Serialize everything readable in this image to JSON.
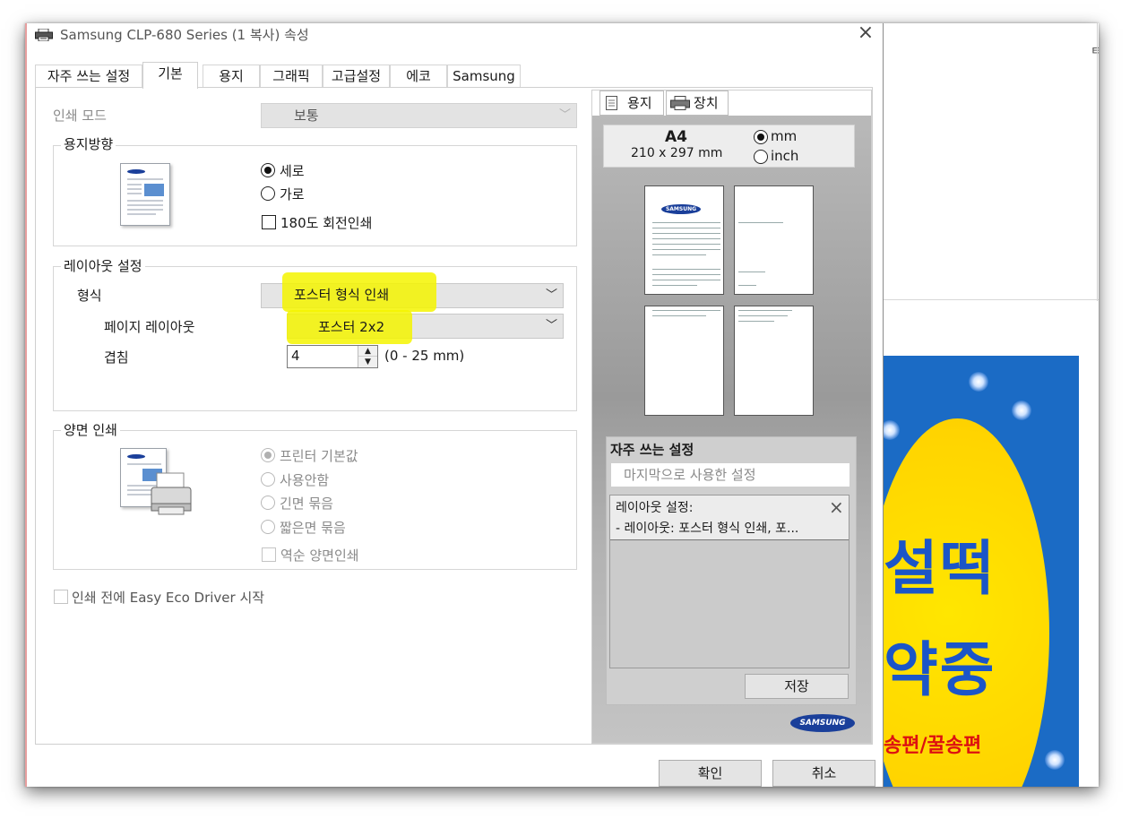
{
  "window": {
    "title": "Samsung CLP-680 Series (1 복사) 속성",
    "close_symbol": "×"
  },
  "tabs": [
    "자주 쓰는 설정",
    "기본",
    "용지",
    "그래픽",
    "고급설정",
    "에코",
    "Samsung"
  ],
  "active_tab": "기본",
  "print_mode": {
    "label": "인쇄 모드",
    "value": "보통"
  },
  "orientation": {
    "title": "용지방향",
    "portrait": "세로",
    "landscape": "가로",
    "rotate_180": "180도 회전인쇄",
    "selected": "세로"
  },
  "layout": {
    "title": "레이아웃 설정",
    "type_label": "형식",
    "type_value": "포스터 형식 인쇄",
    "page_layout_label": "페이지 레이아웃",
    "page_layout_value": "포스터 2x2",
    "overlap_label": "겹침",
    "overlap_value": "4",
    "overlap_range": "(0 - 25 mm)"
  },
  "duplex": {
    "title": "양면 인쇄",
    "options": [
      "프린터 기본값",
      "사용안함",
      "긴면 묶음",
      "짧은면 묶음"
    ],
    "selected": "프린터 기본값",
    "reverse": "역순 양면인쇄"
  },
  "eco_checkbox": "인쇄 전에 Easy Eco Driver 시작",
  "preview": {
    "tab_paper": "용지",
    "tab_device": "장치",
    "paper_name": "A4",
    "paper_dims": "210 x 297 mm",
    "unit_mm": "mm",
    "unit_inch": "inch",
    "unit_selected": "mm",
    "logo_small": "SAMSUNG"
  },
  "favorites": {
    "title": "자주 쓰는 설정",
    "placeholder": "마지막으로 사용한 설정",
    "item_title": "레이아웃 설정:",
    "item_detail": "- 레이아웃: 포스터 형식 인쇄, 포...",
    "item_close": "×",
    "save": "저장"
  },
  "brand_logo": "SAMSUNG",
  "buttons": {
    "ok": "확인",
    "cancel": "취소"
  },
  "background_window": {
    "stub_text": "ㅌ",
    "poster_line1": "설떡",
    "poster_line2": "약중",
    "poster_line3": "송편/꿀송편"
  },
  "colors": {
    "highlight": "#f4f400",
    "poster_blue": "#1b6bc5",
    "poster_yellow": "#ffd400",
    "samsung_blue": "#1a3f9a"
  }
}
